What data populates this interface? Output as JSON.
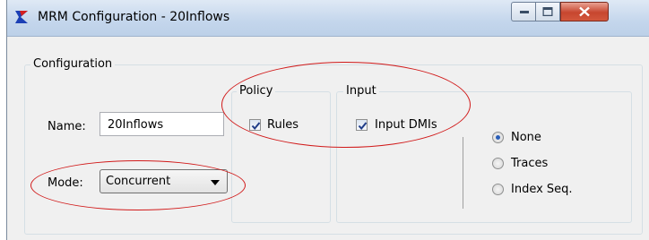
{
  "window": {
    "title": "MRM Configuration - 20Inflows",
    "controls": [
      "minimize-icon",
      "maximize-icon",
      "close-icon"
    ]
  },
  "configuration": {
    "legend": "Configuration",
    "name_label": "Name:",
    "name_value": "20Inflows",
    "mode_label": "Mode:",
    "mode_value": "Concurrent"
  },
  "policy": {
    "legend": "Policy",
    "rules_label": "Rules",
    "rules_checked": true
  },
  "input": {
    "legend": "Input",
    "input_dmis_label": "Input DMIs",
    "input_dmis_checked": true,
    "radio_options": [
      {
        "label": "None",
        "selected": true
      },
      {
        "label": "Traces",
        "selected": false
      },
      {
        "label": "Index Seq.",
        "selected": false
      }
    ]
  },
  "colors": {
    "annotation": "#d11a1a",
    "accent": "#2a5eb8"
  }
}
